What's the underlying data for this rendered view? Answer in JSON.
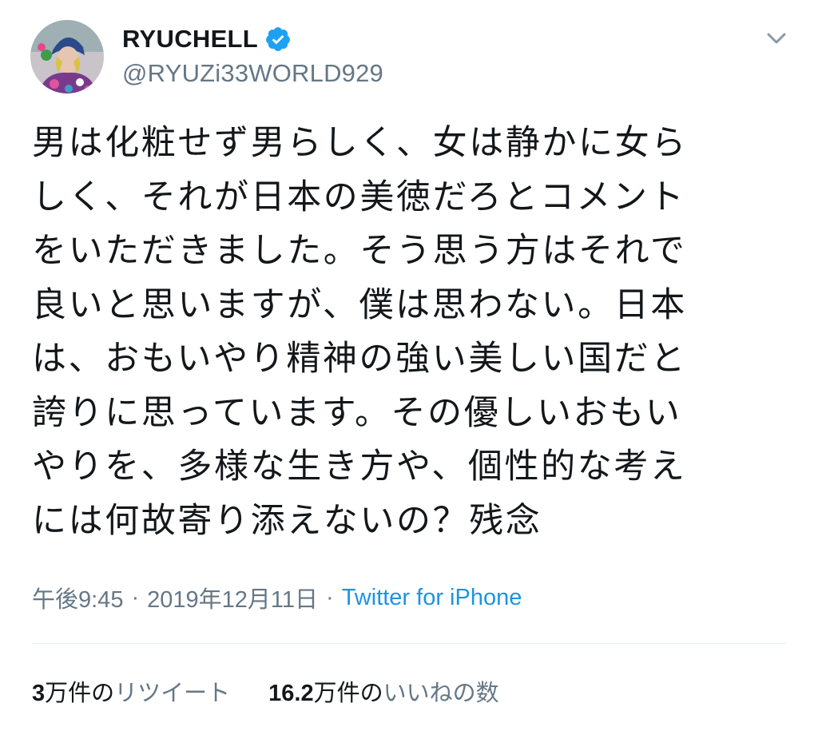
{
  "author": {
    "display_name": "RYUCHELL",
    "handle": "@RYUZi33WORLD929",
    "verified": true,
    "avatar_icon": "profile-photo"
  },
  "menu": {
    "icon": "chevron-down-icon"
  },
  "tweet": {
    "lines": [
      "男は化粧せず男らしく、女は静かに女ら",
      "しく、それが日本の美徳だろとコメント",
      "をいただきました。そう思う方はそれで",
      "良いと思いますが、僕は思わない。日本",
      "は、おもいやり精神の強い美しい国だと",
      "誇りに思っています。その優しいおもい",
      "やりを、多様な生き方や、個性的な考え",
      "には何故寄り添えないの？残念"
    ]
  },
  "meta": {
    "time": "午後9:45",
    "separator": "·",
    "date": "2019年12月11日",
    "source": "Twitter for iPhone"
  },
  "stats": {
    "retweets": {
      "count": "3",
      "unit": "万件の",
      "label": "リツイート"
    },
    "likes": {
      "count": "16.2",
      "unit": "万件の",
      "label": "いいねの数"
    }
  },
  "colors": {
    "text": "#14171a",
    "secondary": "#657786",
    "link": "#1b95e0",
    "verified": "#1da1f2",
    "divider": "#e6ecf0"
  }
}
